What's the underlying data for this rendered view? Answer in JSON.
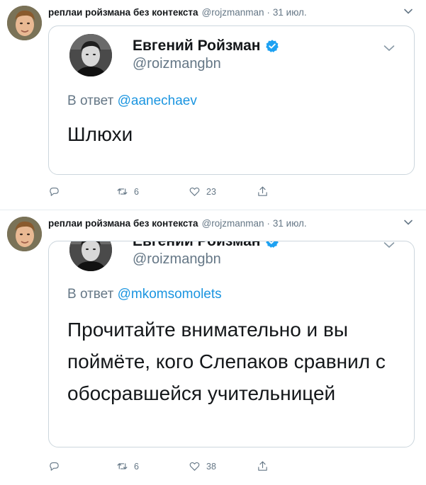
{
  "tweets": [
    {
      "author_name": "реплаи ройзмана без контекста",
      "author_handle": "@rojzmanman",
      "separator": "·",
      "time": "31 июл.",
      "quoted": {
        "name": "Евгений Ройзман",
        "handle": "@roizmangbn",
        "reply_prefix": "В ответ",
        "reply_mention": "@aanechaev",
        "text": "Шлюхи"
      },
      "retweets": "6",
      "likes": "23"
    },
    {
      "author_name": "реплаи ройзмана без контекста",
      "author_handle": "@rojzmanman",
      "separator": "·",
      "time": "31 июл.",
      "quoted": {
        "name": "Евгений Ройзман",
        "handle": "@roizmangbn",
        "reply_prefix": "В ответ",
        "reply_mention": "@mkomsomolets",
        "text": "Прочитайте внимательно и вы поймёте, кого Слепаков сравнил с обосравшейся учительницей"
      },
      "retweets": "6",
      "likes": "38"
    }
  ],
  "colors": {
    "text": "#14171a",
    "secondary": "#657786",
    "link": "#1b95e0",
    "verified": "#1da1f2",
    "border": "#ccd6dd"
  },
  "icons": [
    "reply-icon",
    "retweet-icon",
    "like-icon",
    "share-icon",
    "chevron-down-icon",
    "verified-badge-icon"
  ]
}
